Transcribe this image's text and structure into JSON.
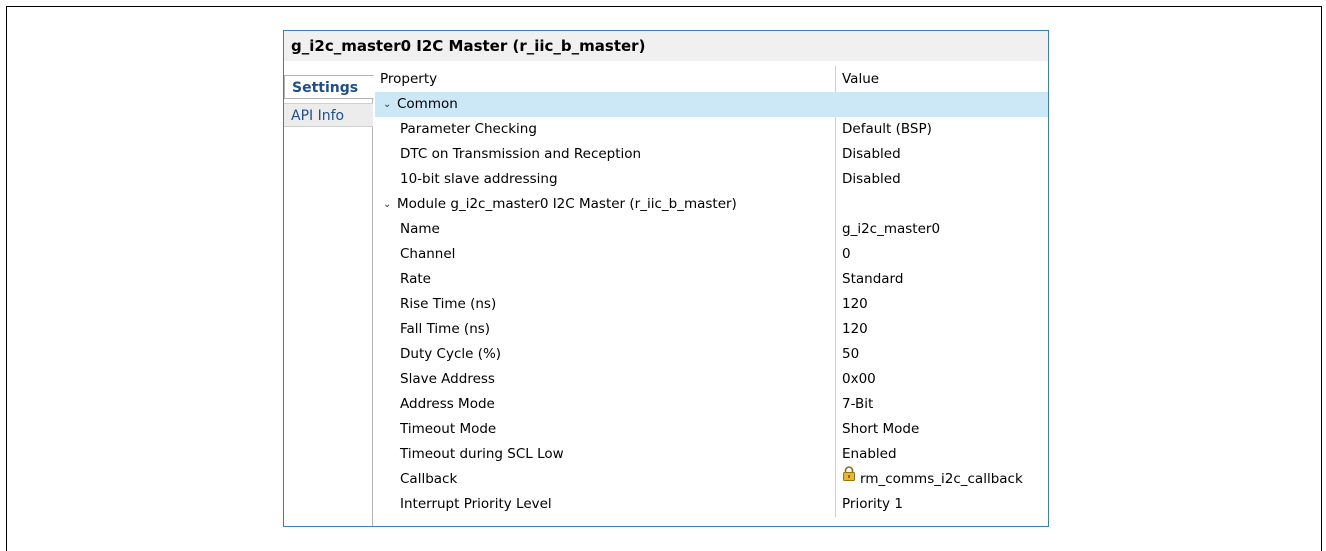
{
  "panel": {
    "title": "g_i2c_master0 I2C Master (r_iic_b_master)",
    "tabs": [
      {
        "label": "Settings",
        "active": true
      },
      {
        "label": "API Info",
        "active": false
      }
    ]
  },
  "table": {
    "headers": {
      "property": "Property",
      "value": "Value"
    },
    "groups": [
      {
        "label": "Common",
        "rows": [
          {
            "property": "Parameter Checking",
            "value": "Default (BSP)"
          },
          {
            "property": "DTC on Transmission and Reception",
            "value": "Disabled"
          },
          {
            "property": "10-bit slave addressing",
            "value": "Disabled"
          }
        ]
      },
      {
        "label": "Module g_i2c_master0 I2C Master (r_iic_b_master)",
        "rows": [
          {
            "property": "Name",
            "value": "g_i2c_master0"
          },
          {
            "property": "Channel",
            "value": "0"
          },
          {
            "property": "Rate",
            "value": "Standard"
          },
          {
            "property": "Rise Time (ns)",
            "value": "120"
          },
          {
            "property": "Fall Time (ns)",
            "value": "120"
          },
          {
            "property": "Duty Cycle (%)",
            "value": "50"
          },
          {
            "property": "Slave Address",
            "value": "0x00"
          },
          {
            "property": "Address Mode",
            "value": "7-Bit"
          },
          {
            "property": "Timeout Mode",
            "value": "Short Mode"
          },
          {
            "property": "Timeout during SCL Low",
            "value": "Enabled"
          },
          {
            "property": "Callback",
            "value": "rm_comms_i2c_callback",
            "icon": "lock-icon"
          },
          {
            "property": "Interrupt Priority Level",
            "value": "Priority 1"
          }
        ]
      }
    ]
  },
  "colors": {
    "selected_row": "#cce8f7",
    "panel_border": "#3c7fb1",
    "tab_text": "#1f4e8a"
  }
}
